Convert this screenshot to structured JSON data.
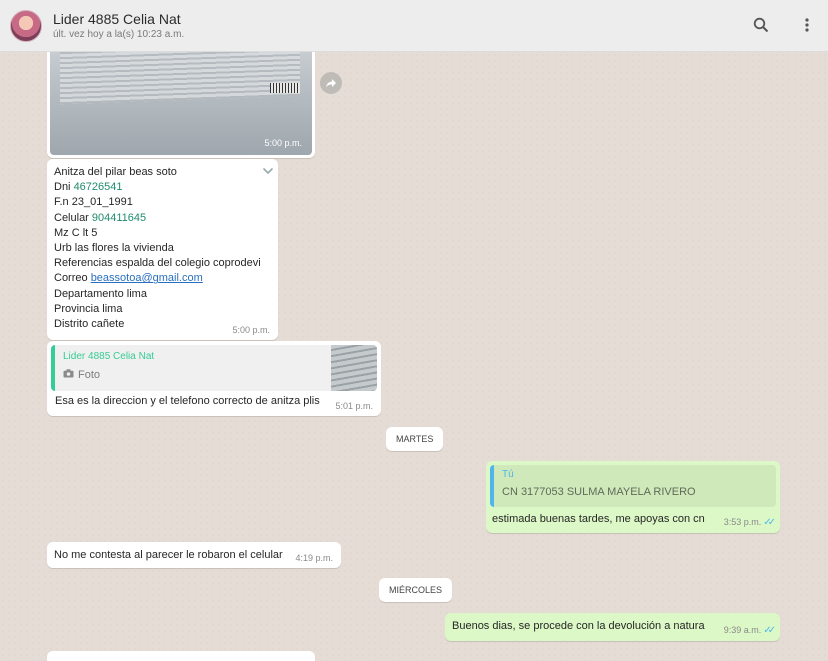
{
  "header": {
    "title": "Lider 4885 Celia Nat",
    "subtitle": "últ. vez hoy a la(s) 10:23 a.m.",
    "icons": [
      "search-icon",
      "menu-icon"
    ]
  },
  "messages": {
    "photo": {
      "time": "5:00 p.m."
    },
    "contact": {
      "lines": {
        "name": "Anitza del pilar beas soto",
        "dni_label": "Dni ",
        "dni_value": "46726541",
        "fn": "F.n 23_01_1991",
        "cel_label": "Celular ",
        "cel_value": "904411645",
        "mz": "Mz C lt 5",
        "urb": "Urb las flores la vivienda",
        "ref": "Referencias espalda del colegio coprodevi",
        "mail_label": "Correo ",
        "mail_value": "beassotoa@gmail.com",
        "dep": "Departamento lima",
        "prov": "Provincia lima",
        "dist": "Distrito cañete"
      },
      "time": "5:00 p.m."
    },
    "quoted": {
      "author": "Lider 4885 Celia Nat",
      "type": "Foto",
      "text": "Esa es la direccion y el telefono correcto de anitza  plis",
      "time": "5:01 p.m."
    },
    "date_tuesday": "MARTES",
    "reply_out": {
      "author": "Tú",
      "quoted_text": "CN 3177053 SULMA MAYELA RIVERO",
      "text": "estimada buenas tardes,  me apoyas con cn",
      "time": "3:53 p.m."
    },
    "incoming_2": {
      "text": "No me contesta al parecer le robaron el celular",
      "time": "4:19 p.m."
    },
    "date_wednesday": "MIÉRCOLES",
    "outgoing_2": {
      "text": "Buenos dias, se procede con la devolución a natura",
      "time": "9:39 a.m."
    }
  },
  "colors": {
    "header_bg": "#ededed",
    "chat_bg": "#e5ddd5",
    "incoming_bubble": "#ffffff",
    "outgoing_bubble": "#dcf8c6",
    "accent_green": "#35cd96",
    "tick_blue": "#4fb6ec"
  }
}
